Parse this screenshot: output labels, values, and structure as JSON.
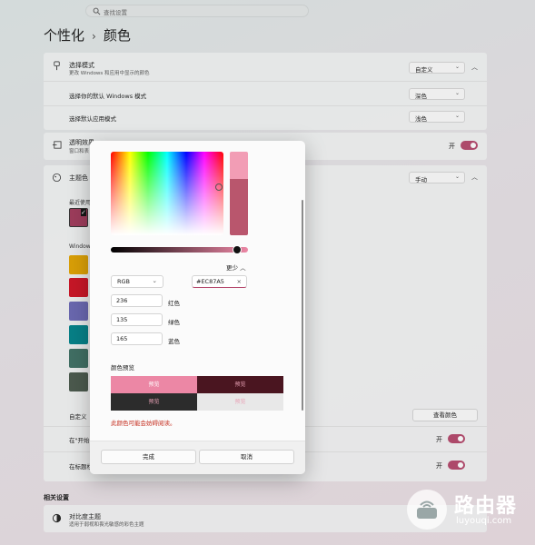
{
  "search": {
    "placeholder": "查找设置"
  },
  "breadcrumb": {
    "parent": "个性化",
    "separator": "›",
    "current": "颜色"
  },
  "mode_section": {
    "title": "选择模式",
    "subtitle": "更改 Windows 和应用中显示的颜色",
    "value": "自定义",
    "windows_mode_label": "选择你的默认 Windows 模式",
    "windows_mode_value": "深色",
    "app_mode_label": "选择默认应用模式",
    "app_mode_value": "浅色"
  },
  "transparency": {
    "title": "透明效果",
    "subtitle": "窗口和表",
    "toggle_label": "开"
  },
  "accent": {
    "title": "主题色",
    "value": "手动",
    "recent_label": "最近使用",
    "windows_colors_label": "Window",
    "custom_label": "自定义",
    "view_colors_button": "查看颜色",
    "start_label": "在\"开始\"",
    "start_toggle": "开",
    "title_bar_label": "在标题栏",
    "title_bar_toggle": "开"
  },
  "swatch_colors": [
    "#a23a5c",
    "#e3a400",
    "#d01223",
    "#6b69b6",
    "#00838a",
    "#3e7064",
    "#4a5a4d"
  ],
  "related": {
    "heading": "相关设置",
    "contrast_title": "对比度主题",
    "contrast_subtitle": "适用于弱视和畏光敏感的彩色主题"
  },
  "dialog": {
    "less_label": "更少",
    "model_value": "RGB",
    "hex_value": "#EC87A5",
    "red_value": "236",
    "red_label": "红色",
    "green_value": "135",
    "green_label": "绿色",
    "blue_value": "165",
    "blue_label": "蓝色",
    "preview_title": "颜色预览",
    "preview_labels": [
      "预览",
      "预览",
      "预览",
      "预览"
    ],
    "warning": "此颜色可能会妨碍阅读。",
    "done_button": "完成",
    "cancel_button": "取消",
    "current_color": "#ec87a5"
  },
  "watermark": {
    "brand": "路由器",
    "url": "luyouqi.com"
  }
}
